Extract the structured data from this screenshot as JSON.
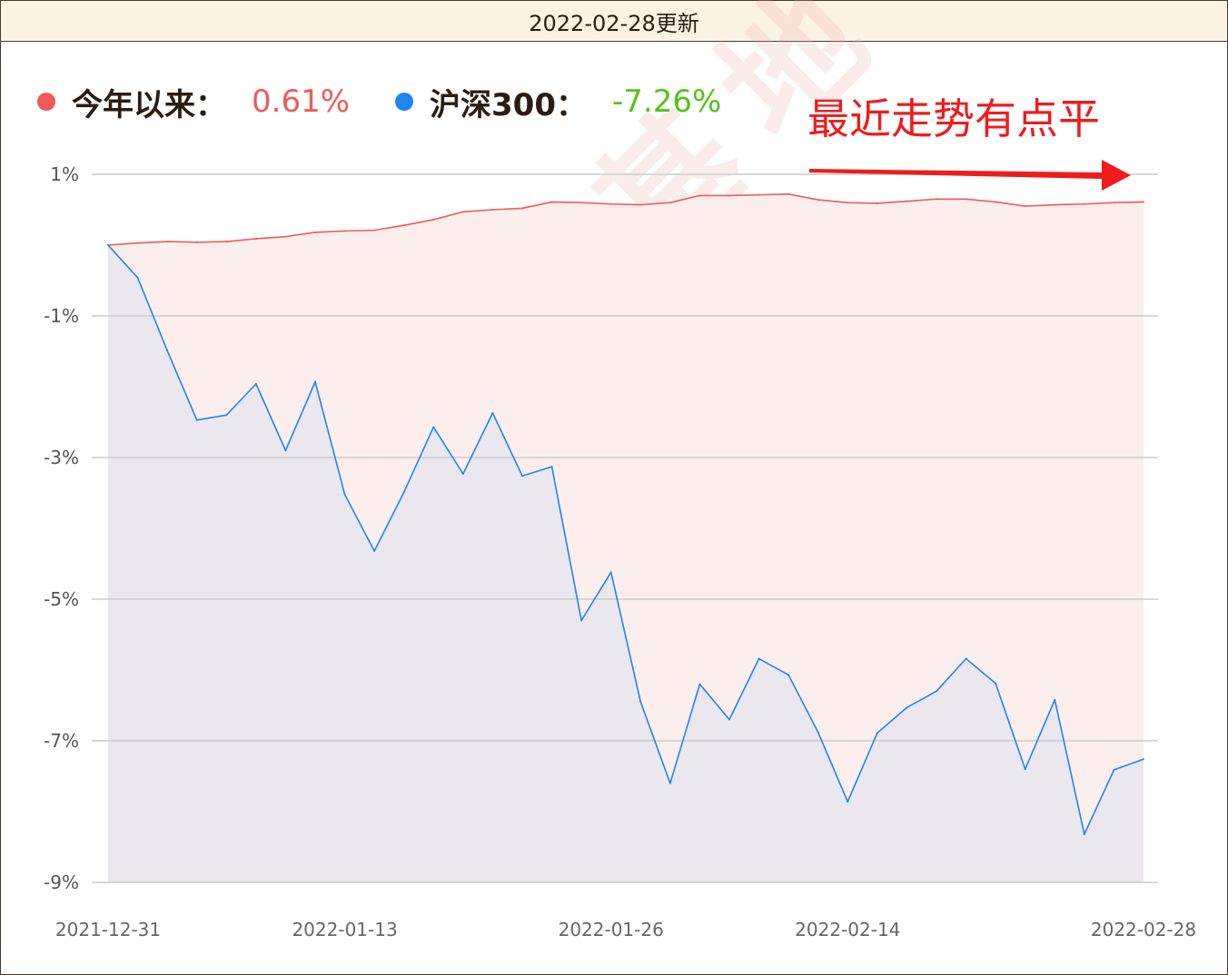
{
  "header": {
    "title": "2022-02-28更新"
  },
  "legend": {
    "items": [
      {
        "label": "今年以来：",
        "value": "0.61%",
        "dot_color": "#f05a5a",
        "value_color": "#f05a5a"
      },
      {
        "label": "沪深300：",
        "value": "-7.26%",
        "dot_color": "#1e86f0",
        "value_color": "#52c41a"
      }
    ]
  },
  "annotation": {
    "text": "最近走势有点平",
    "color": "#ee1c1c"
  },
  "watermark": "搞钱基地",
  "chart_data": {
    "type": "area",
    "y_ticks": [
      "1%",
      "-1%",
      "-3%",
      "-5%",
      "-7%",
      "-9%"
    ],
    "y_tick_values": [
      1,
      -1,
      -3,
      -5,
      -7,
      -9
    ],
    "ylim": [
      -9,
      1
    ],
    "x_tick_labels": [
      "2021-12-31",
      "2022-01-13",
      "2022-01-26",
      "2022-02-14",
      "2022-02-28"
    ],
    "x_tick_indices": [
      0,
      8,
      17,
      25,
      35
    ],
    "grid": true,
    "legend_position": "top-left",
    "series": [
      {
        "name": "今年以来",
        "color": "#f05a5a",
        "fill": "#fdeeee",
        "values": [
          0.0,
          0.03,
          0.05,
          0.04,
          0.05,
          0.09,
          0.12,
          0.18,
          0.2,
          0.21,
          0.28,
          0.36,
          0.47,
          0.5,
          0.52,
          0.61,
          0.6,
          0.58,
          0.57,
          0.6,
          0.7,
          0.7,
          0.71,
          0.72,
          0.64,
          0.6,
          0.59,
          0.62,
          0.65,
          0.65,
          0.61,
          0.55,
          0.57,
          0.58,
          0.6,
          0.61
        ]
      },
      {
        "name": "沪深300",
        "color": "#1e86f0",
        "fill": "#ebe7ef",
        "values": [
          0.0,
          -0.46,
          -1.49,
          -2.47,
          -2.4,
          -1.96,
          -2.9,
          -1.93,
          -3.52,
          -4.32,
          -3.49,
          -2.57,
          -3.23,
          -2.37,
          -3.26,
          -3.13,
          -5.3,
          -4.62,
          -6.45,
          -7.6,
          -6.2,
          -6.7,
          -5.84,
          -6.07,
          -6.88,
          -7.86,
          -6.89,
          -6.53,
          -6.3,
          -5.84,
          -6.19,
          -7.4,
          -6.42,
          -8.32,
          -7.41,
          -7.26
        ]
      }
    ]
  }
}
